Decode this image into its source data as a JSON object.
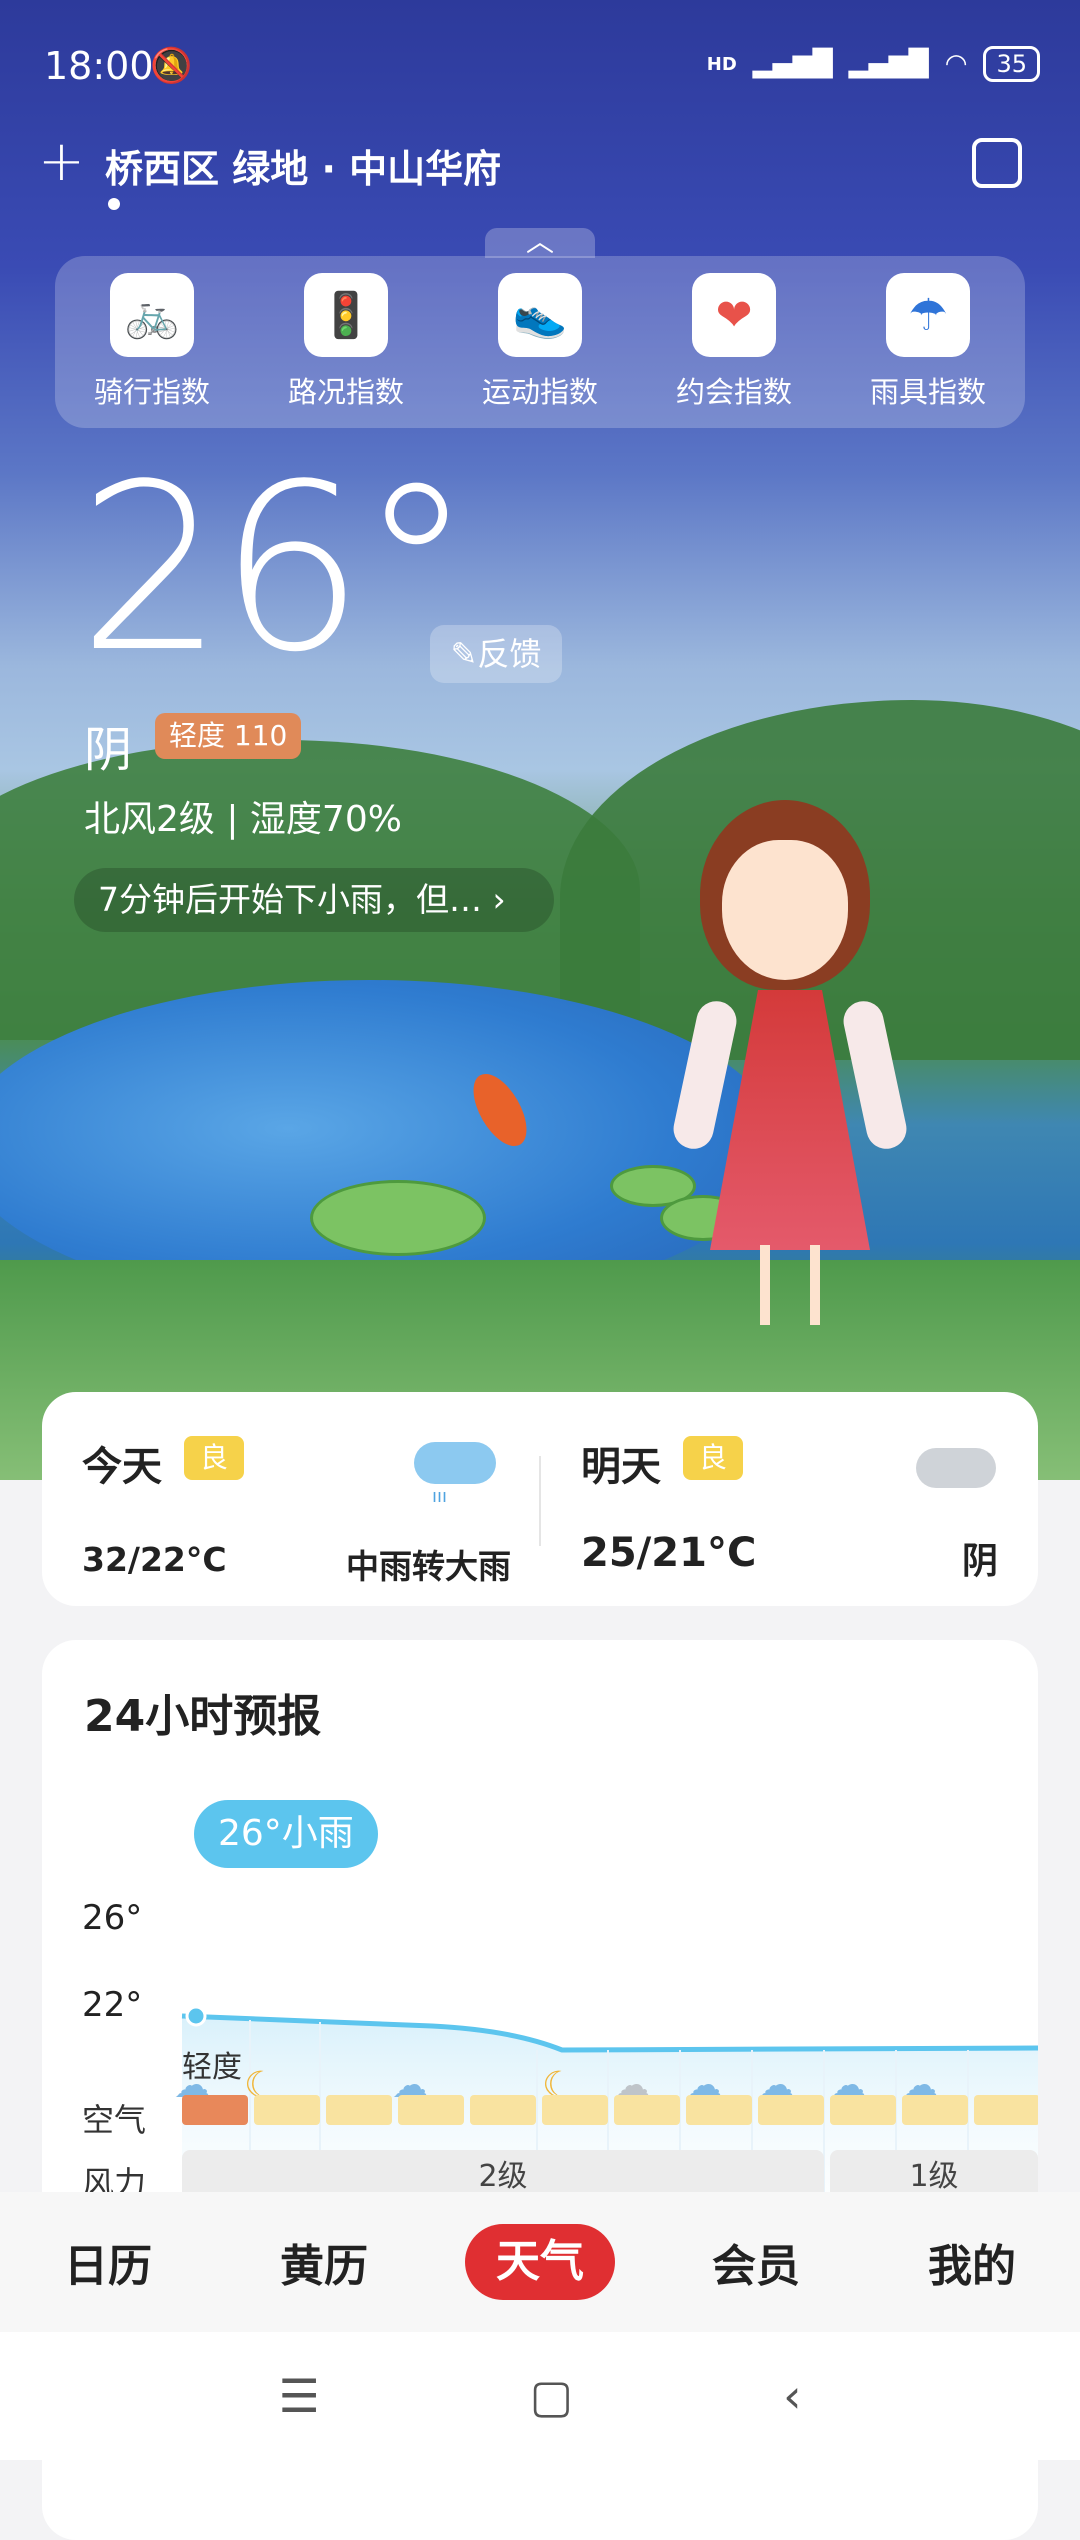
{
  "status_bar": {
    "time": "18:00",
    "signal_label": "HD",
    "battery": "35"
  },
  "header": {
    "location": "桥西区  绿地 · 中山华府"
  },
  "index_panel": {
    "items": [
      {
        "label": "骑行指数",
        "icon": "bike-icon",
        "color": "#2aa7e0"
      },
      {
        "label": "路况指数",
        "icon": "traffic-light-icon",
        "color": "#f3a31b"
      },
      {
        "label": "运动指数",
        "icon": "running-shoe-icon",
        "color": "#36b24a"
      },
      {
        "label": "约会指数",
        "icon": "heart-icon",
        "color": "#e8524a"
      },
      {
        "label": "雨具指数",
        "icon": "umbrella-icon",
        "color": "#2f74d8"
      }
    ]
  },
  "current": {
    "temperature": "26°",
    "feedback": "反馈",
    "condition": "阴",
    "aqi_badge": "轻度 110",
    "wind_humidity": "北风2级 | 湿度70%",
    "alert": "7分钟后开始下小雨，但… ›"
  },
  "days": {
    "today": {
      "name": "今天",
      "quality": "良",
      "temp": "32/22°C",
      "condition": "中雨转大雨"
    },
    "tomorrow": {
      "name": "明天",
      "quality": "良",
      "temp": "25/21°C",
      "condition": "阴"
    }
  },
  "forecast": {
    "title": "24小时预报",
    "bubble": "26°小雨",
    "y_labels": [
      "26°",
      "22°"
    ],
    "aqi_level_label": "轻度",
    "aqi_row_label": "空气",
    "wind_row_label": "风力",
    "wind_segments": [
      "2级",
      "1级"
    ],
    "icons": [
      "rain-cloud-icon",
      "moon-cloud-icon",
      "rain-cloud-icon",
      "moon-cloud-icon",
      "cloud-icon",
      "rain-cloud-icon",
      "rain-cloud-icon",
      "rain-cloud-icon",
      "rain-cloud-icon"
    ]
  },
  "colors": {
    "aqi_light": "#e8885a",
    "aqi_good": "#f9e3a0",
    "accent_red": "#e02f32",
    "line": "#5cc5ee",
    "quality_badge": "#f6d24a"
  },
  "bottom_nav": {
    "items": [
      "日历",
      "黄历",
      "天气",
      "会员",
      "我的"
    ],
    "active": "天气"
  },
  "system_nav": [
    "menu-icon",
    "home-icon",
    "back-icon"
  ]
}
